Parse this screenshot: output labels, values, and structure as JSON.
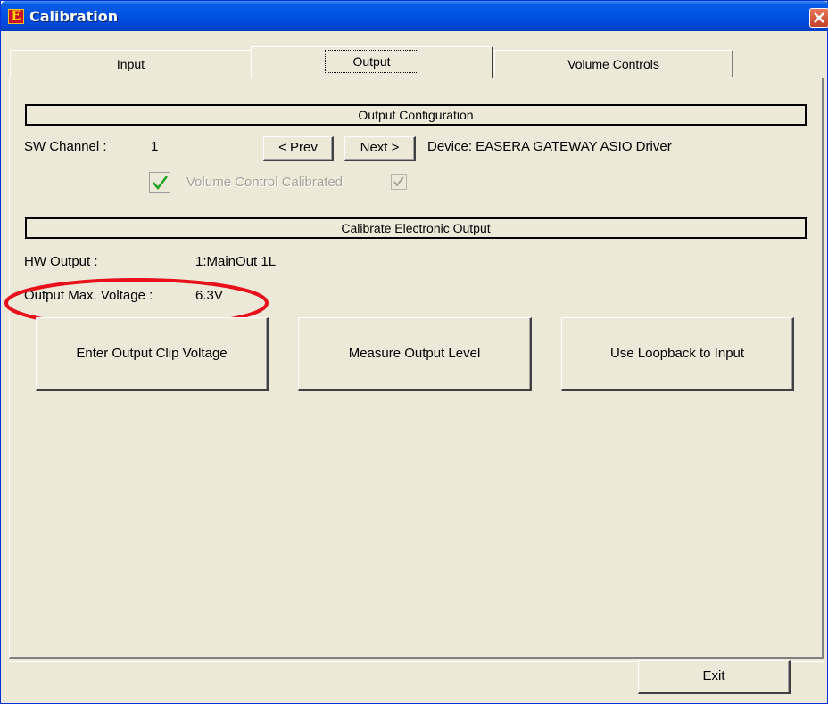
{
  "window": {
    "title": "Calibration",
    "app_icon_letter": "E",
    "titlebar_color": "#0052E3",
    "close_color": "#D5502F"
  },
  "tabs": [
    {
      "label": "Input",
      "active": false
    },
    {
      "label": "Output",
      "active": true
    },
    {
      "label": "Volume Controls",
      "active": false
    }
  ],
  "output_config": {
    "header": "Output Configuration",
    "sw_channel_label": "SW Channel :",
    "sw_channel_value": "1",
    "prev_label": "< Prev",
    "next_label": "Next >",
    "device_text": "Device: EASERA GATEWAY ASIO Driver",
    "volume_calibrated_label": "Volume Control Calibrated",
    "volume_calibrated_checked": true
  },
  "calibrate_output": {
    "header": "Calibrate Electronic Output",
    "hw_output_label": "HW Output :",
    "hw_output_value": "1:MainOut 1L",
    "max_voltage_label": "Output Max. Voltage :",
    "max_voltage_value": "6.3V",
    "highlight_color": "#E8101A",
    "buttons": {
      "enter_clip": "Enter Output Clip Voltage",
      "measure_level": "Measure Output Level",
      "loopback": "Use Loopback to Input"
    }
  },
  "footer": {
    "exit_label": "Exit"
  }
}
